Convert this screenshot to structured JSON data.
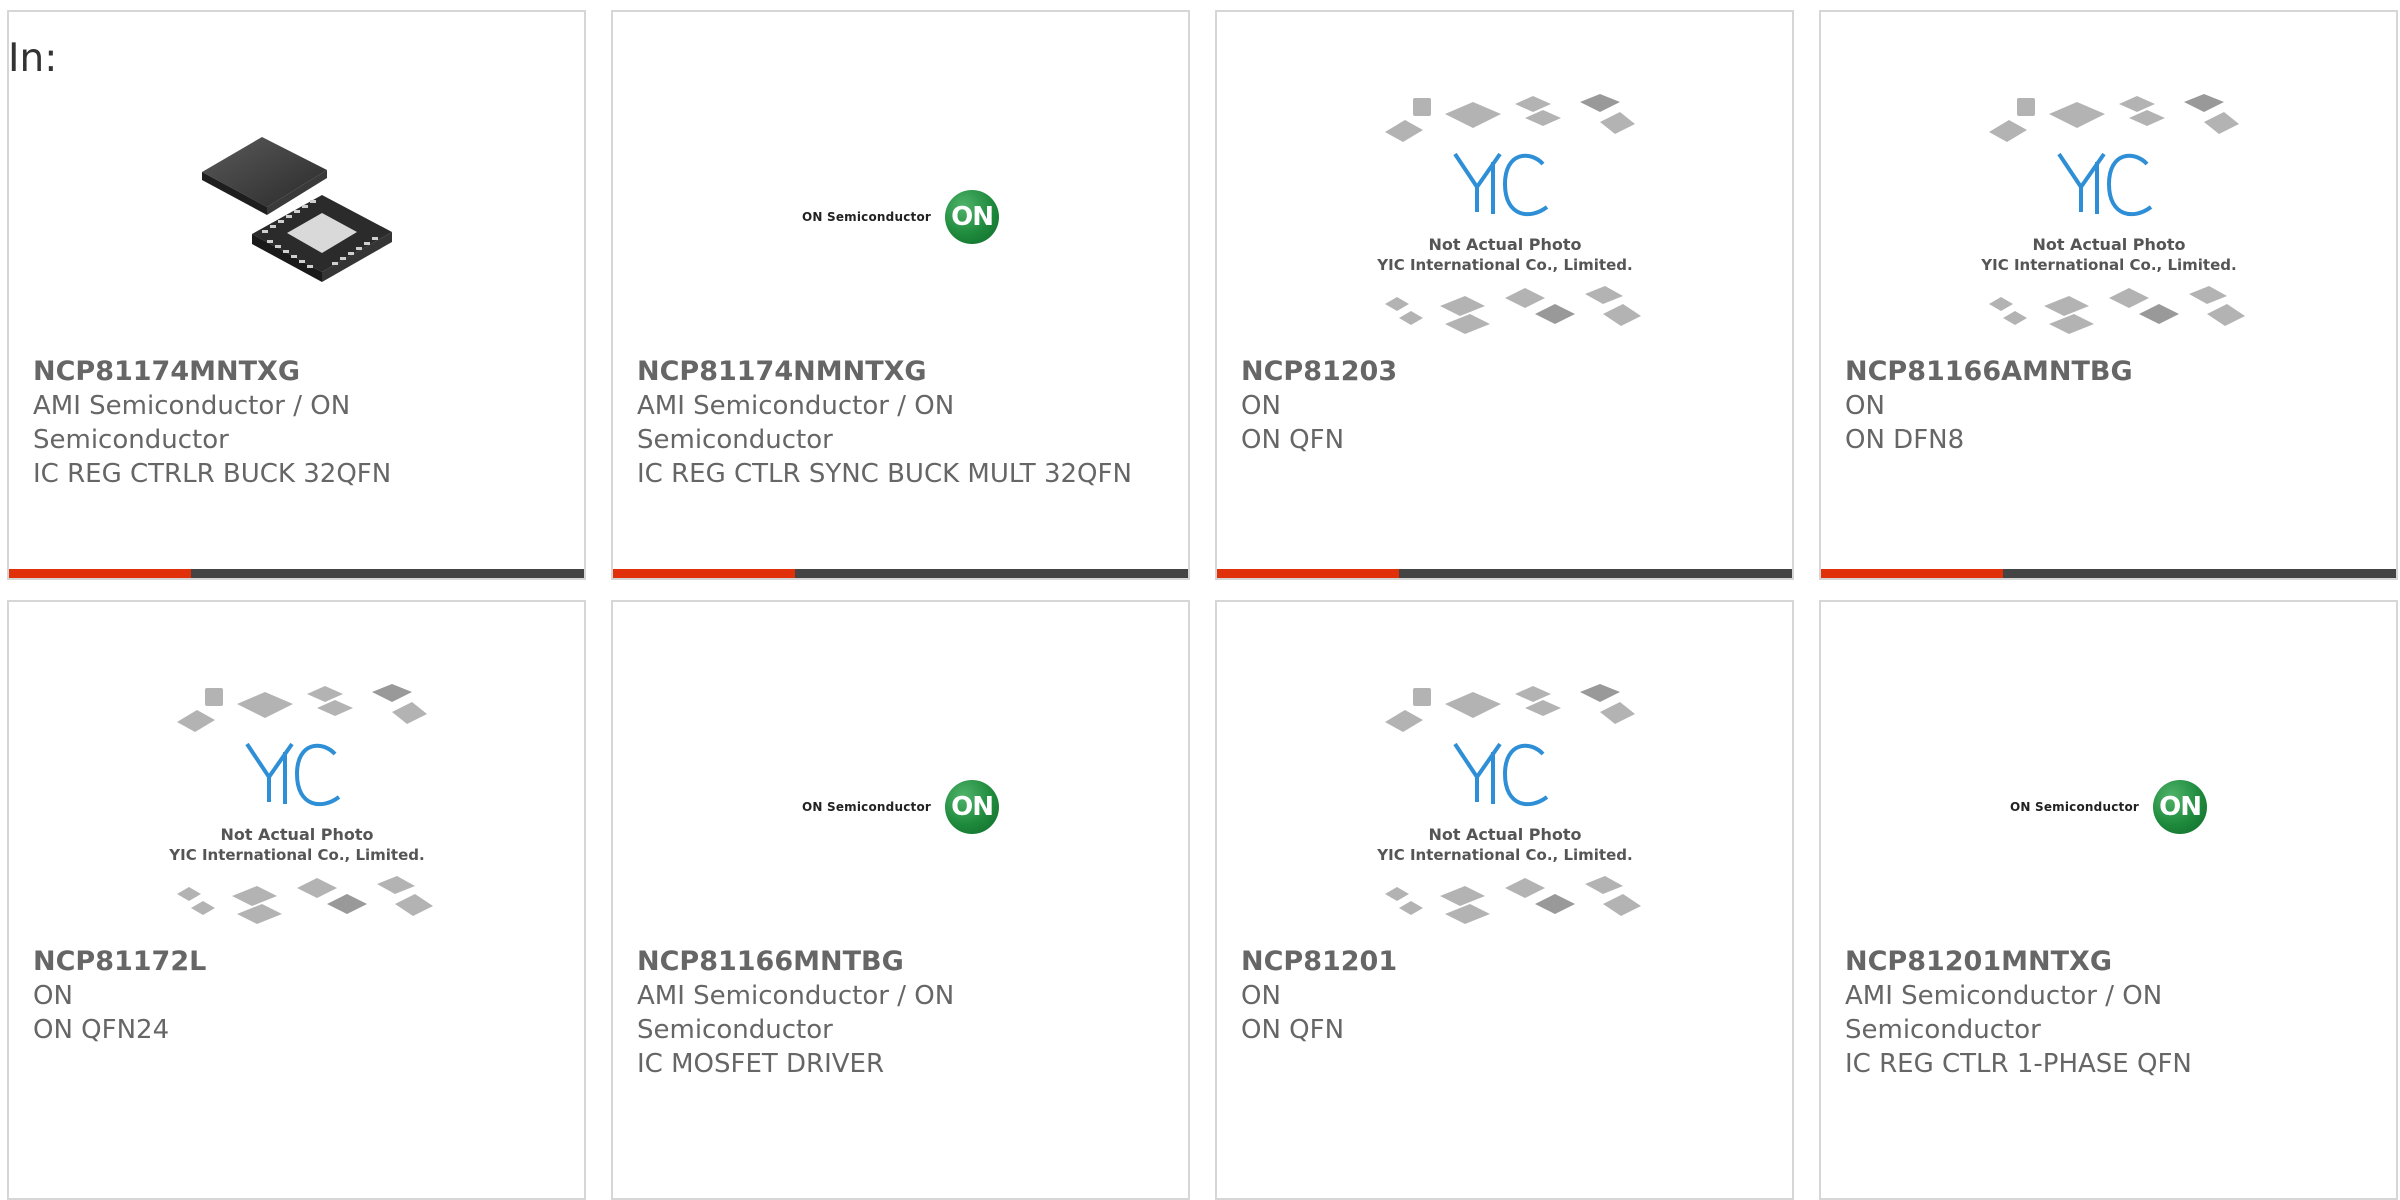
{
  "header": {
    "in_label": "In:"
  },
  "products": [
    {
      "part": "NCP81174MNTXG",
      "manufacturer": "AMI Semiconductor / ON Semiconductor",
      "description": "IC REG CTRLR BUCK 32QFN",
      "image_type": "chip-photo"
    },
    {
      "part": "NCP81174NMNTXG",
      "manufacturer": "AMI Semiconductor / ON Semiconductor",
      "description": "IC REG CTLR SYNC BUCK MULT 32QFN",
      "image_type": "on-semiconductor-logo"
    },
    {
      "part": "NCP81203",
      "manufacturer": "ON",
      "description": "ON QFN",
      "image_type": "yic-placeholder"
    },
    {
      "part": "NCP81166AMNTBG",
      "manufacturer": "ON",
      "description": "ON DFN8",
      "image_type": "yic-placeholder"
    },
    {
      "part": "NCP81172L",
      "manufacturer": "ON",
      "description": "ON QFN24",
      "image_type": "yic-placeholder"
    },
    {
      "part": "NCP81166MNTBG",
      "manufacturer": "AMI Semiconductor / ON Semiconductor",
      "description": "IC MOSFET DRIVER",
      "image_type": "on-semiconductor-logo"
    },
    {
      "part": "NCP81201",
      "manufacturer": "ON",
      "description": "ON QFN",
      "image_type": "yic-placeholder"
    },
    {
      "part": "NCP81201MNTXG",
      "manufacturer": "AMI Semiconductor / ON Semiconductor",
      "description": "IC REG CTLR 1-PHASE QFN",
      "image_type": "on-semiconductor-logo"
    }
  ],
  "logos": {
    "on_semiconductor_text": "ON Semiconductor",
    "on_badge_text": "ON",
    "yic_line1": "Not Actual Photo",
    "yic_line2": "YIC International Co., Limited."
  },
  "colors": {
    "accent": "#e1310b",
    "bar": "#444444",
    "card_border": "#d6d6d6",
    "text": "#666666"
  }
}
